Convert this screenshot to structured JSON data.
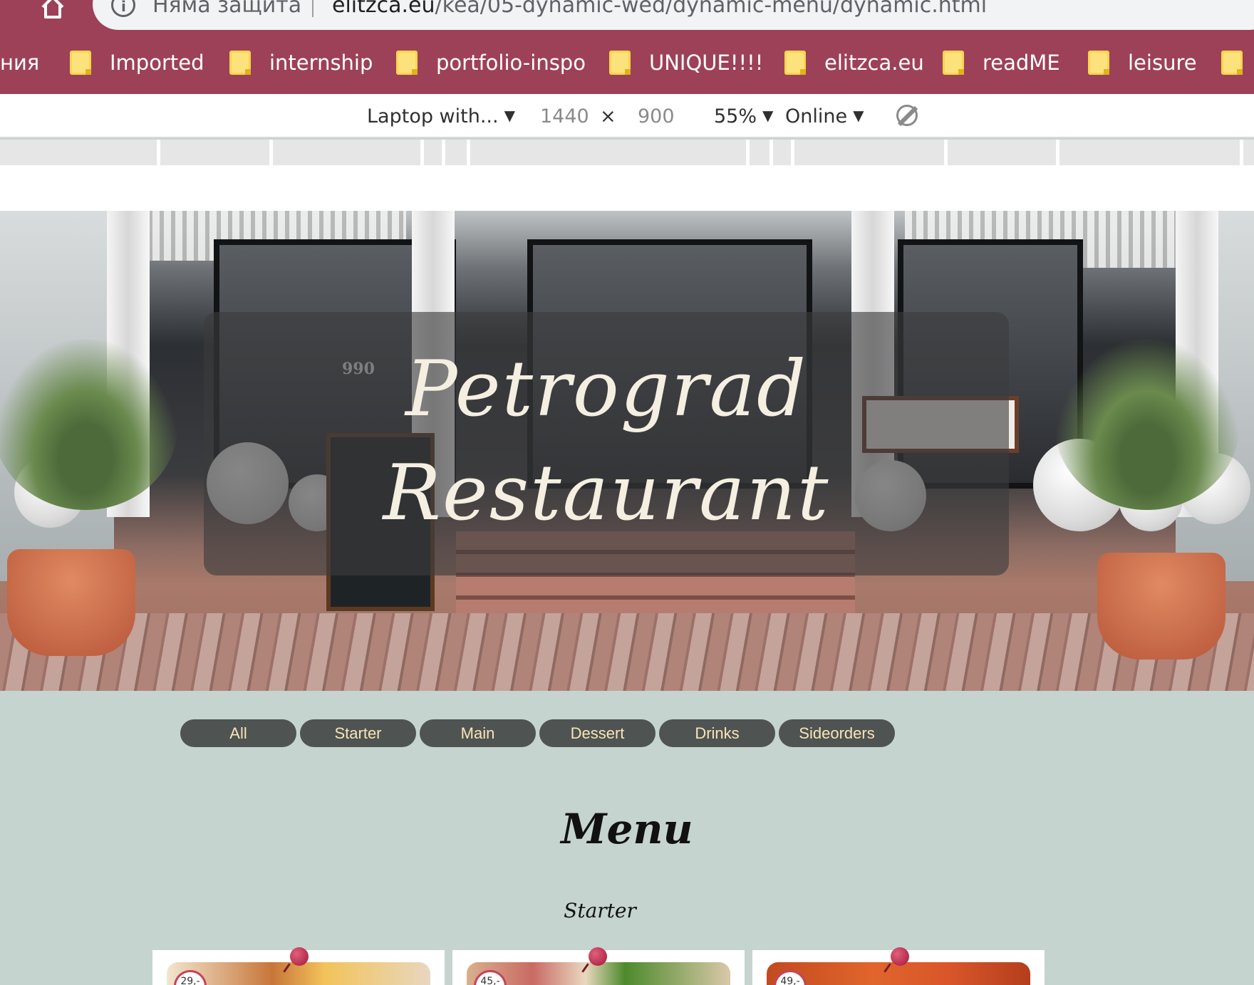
{
  "browser": {
    "security_text": "Няма защита",
    "url_host": "elitzca.eu",
    "url_path": "/kea/05-dynamic-wed/dynamic-menu/dynamic.html",
    "accent_color": "#9d4158"
  },
  "bookmarks": [
    {
      "label": "ния",
      "icon": "folder-icon"
    },
    {
      "label": "Imported",
      "icon": "folder-icon"
    },
    {
      "label": "internship",
      "icon": "folder-icon"
    },
    {
      "label": "portfolio-inspo",
      "icon": "folder-icon"
    },
    {
      "label": "UNIQUE!!!!",
      "icon": "folder-icon"
    },
    {
      "label": "elitzca.eu",
      "icon": "folder-icon"
    },
    {
      "label": "readME",
      "icon": "folder-icon"
    },
    {
      "label": "leisure",
      "icon": "folder-icon"
    }
  ],
  "devtools": {
    "device": "Laptop with...",
    "width": "1440",
    "times": "×",
    "height": "900",
    "zoom": "55%",
    "network": "Online",
    "caret": "▼"
  },
  "hero": {
    "title_line1": "Petrograd",
    "title_line2": "Restaurant",
    "chalkboard_price": "990"
  },
  "filters": [
    "All",
    "Starter",
    "Main",
    "Dessert",
    "Drinks",
    "Sideorders"
  ],
  "menu": {
    "heading": "Menu",
    "section": "Starter",
    "cards": [
      {
        "price": "29,-"
      },
      {
        "price": "45,-"
      },
      {
        "price": "49,-"
      }
    ]
  },
  "colors": {
    "page_bg": "#c5d4ce",
    "filter_bg": "#4f5352",
    "filter_text": "#f7e5b9",
    "pin": "#a3173a"
  }
}
